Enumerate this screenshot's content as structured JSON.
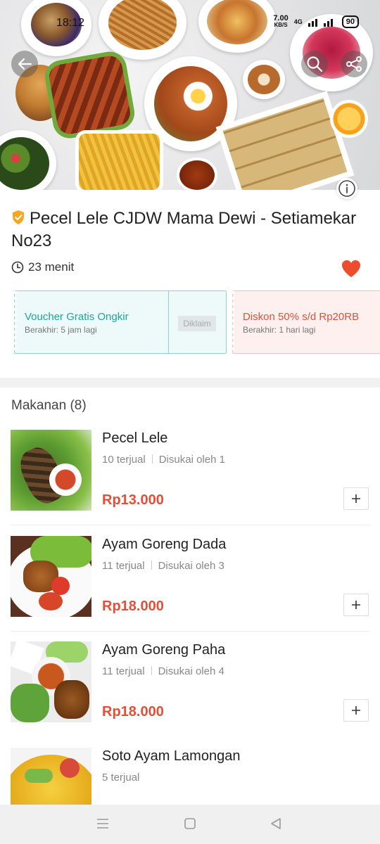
{
  "status_bar": {
    "time": "18:12",
    "speed_value": "7.00",
    "speed_unit": "KB/S",
    "network": "4G",
    "battery": "90"
  },
  "store": {
    "name": "Pecel Lele CJDW Mama Dewi - Setiamekar No23",
    "delivery_time": "23 menit"
  },
  "vouchers": [
    {
      "title": "Voucher Gratis Ongkir",
      "subtitle": "Berakhir: 5 jam lagi",
      "action": "Diklaim"
    },
    {
      "title": "Diskon 50% s/d Rp20RB",
      "subtitle": "Berakhir: 1 hari lagi"
    }
  ],
  "section": {
    "title": "Makanan (8)"
  },
  "items": [
    {
      "name": "Pecel Lele",
      "sold": "10 terjual",
      "liked": "Disukai oleh 1",
      "price": "Rp13.000"
    },
    {
      "name": "Ayam Goreng Dada",
      "sold": "11 terjual",
      "liked": "Disukai oleh 3",
      "price": "Rp18.000"
    },
    {
      "name": "Ayam Goreng Paha",
      "sold": "11 terjual",
      "liked": "Disukai oleh 4",
      "price": "Rp18.000"
    },
    {
      "name": "Soto Ayam Lamongan",
      "sold": "5 terjual"
    }
  ],
  "colors": {
    "accent": "#e2503a",
    "voucher_green": "#1aa69a",
    "heart": "#ee4d2d",
    "badge": "#f5a623"
  },
  "icons": {
    "back": "back-arrow-icon",
    "search": "search-icon",
    "share": "share-icon",
    "info": "info-icon",
    "verified": "verified-badge-icon",
    "clock": "clock-icon",
    "favorite": "heart-icon",
    "add": "plus-icon"
  }
}
